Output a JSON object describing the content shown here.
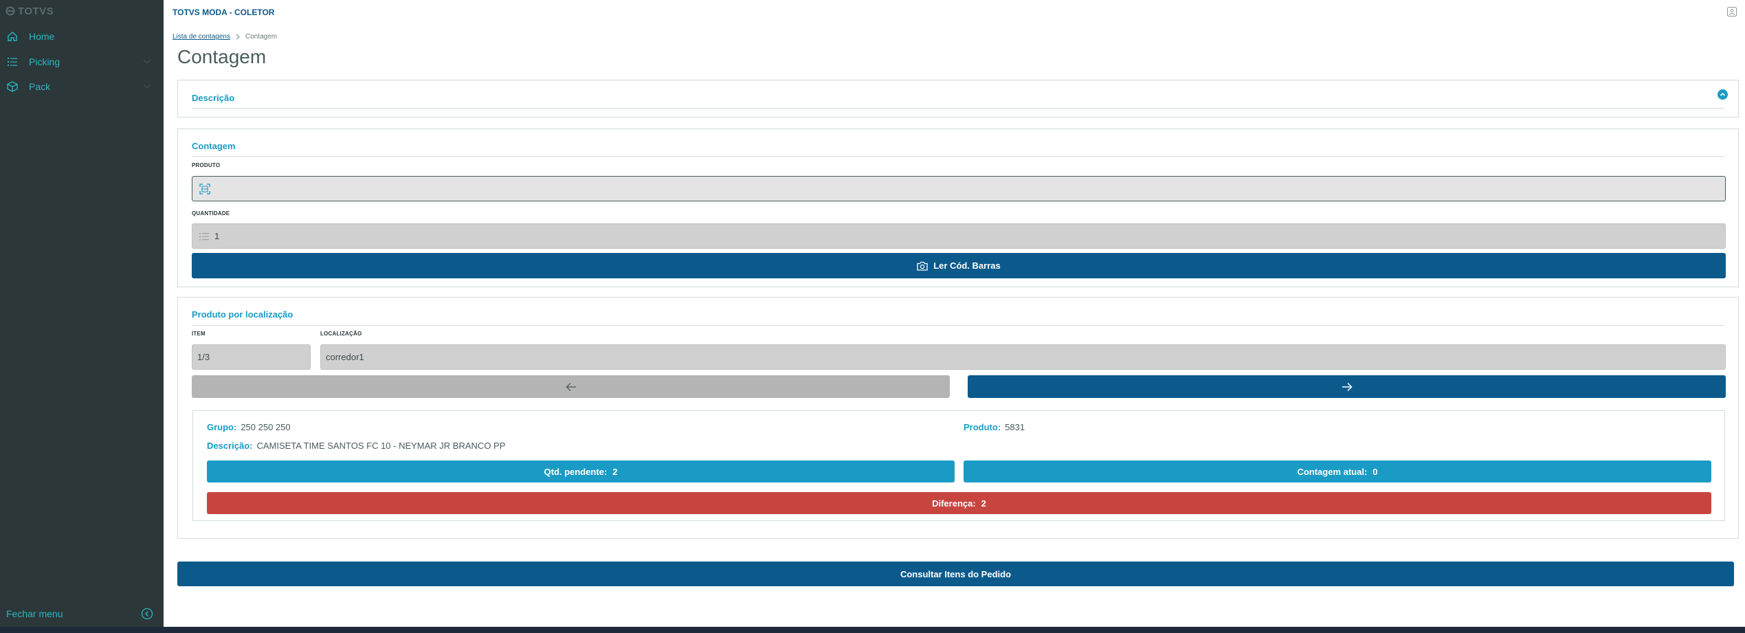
{
  "sidebar": {
    "brand": "TOTVS",
    "items": [
      {
        "label": "Home",
        "icon": "home-icon"
      },
      {
        "label": "Picking",
        "icon": "list-icon"
      },
      {
        "label": "Pack",
        "icon": "box-icon"
      }
    ],
    "close_label": "Fechar menu"
  },
  "header": {
    "app_title": "TOTVS MODA - COLETOR"
  },
  "breadcrumb": {
    "parent": "Lista de contagens",
    "current": "Contagem"
  },
  "page_title": "Contagem",
  "descricao_panel": {
    "title": "Descrição"
  },
  "contagem_panel": {
    "title": "Contagem",
    "produto_label": "PRODUTO",
    "produto_value": "",
    "quantidade_label": "QUANTIDADE",
    "quantidade_value": "1",
    "scan_button": "Ler Cód. Barras"
  },
  "localizacao_panel": {
    "title": "Produto por localização",
    "item_label": "ITEM",
    "item_value": "1/3",
    "localizacao_label": "LOCALIZAÇÃO",
    "localizacao_value": "corredor1",
    "grupo_label": "Grupo:",
    "grupo_value": "250 250 250",
    "produto_label": "Produto:",
    "produto_value": "5831",
    "descricao_label": "Descrição:",
    "descricao_value": "CAMISETA TIME SANTOS FC 10 - NEYMAR JR BRANCO PP",
    "pendente_label": "Qtd. pendente:",
    "pendente_value": "2",
    "atual_label": "Contagem atual:",
    "atual_value": "0",
    "diferenca_label": "Diferença:",
    "diferenca_value": "2"
  },
  "footer_button": "Consultar Itens do Pedido",
  "colors": {
    "sidebar_bg": "#2c3739",
    "accent": "#29b6c5",
    "primary": "#0c5a8c",
    "info": "#1a9bc6",
    "danger": "#c8453f"
  }
}
